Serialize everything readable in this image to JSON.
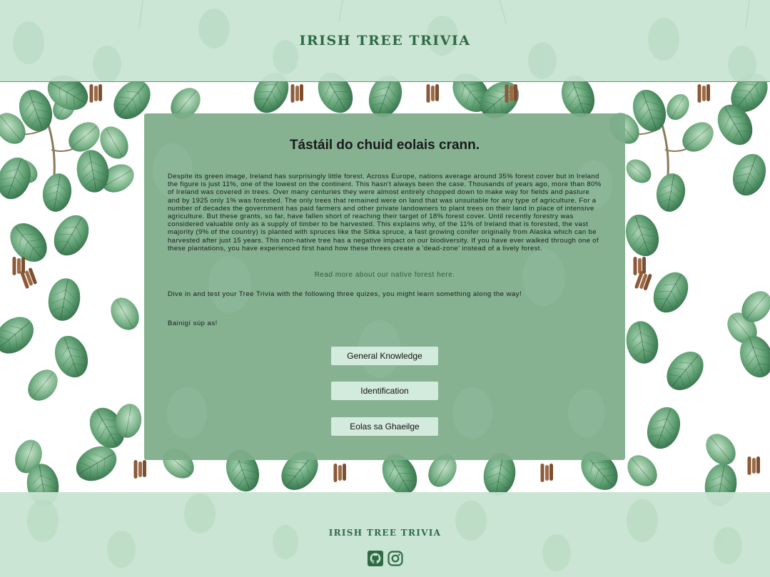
{
  "header": {
    "title": "IRISH TREE TRIVIA"
  },
  "main": {
    "heading": "Tástáil do chuid eolais crann.",
    "intro": "Despite its green image, Ireland has surprisingly little forest. Across Europe, nations average around 35% forest cover but in Ireland the figure is just 11%, one of the lowest on the continent. This hasn't always been the case. Thousands of years ago, more than 80% of Ireland was covered in trees. Over many centuries they were almost entirely chopped down to make way for fields and pasture and by 1925 only 1% was forested. The only trees that remained were on land that was unsuitable for any type of agriculture. For a number of decades the government has paid farmers and other private landowners to plant trees on their land in place of intensive agriculture. But these grants, so far, have fallen short of reaching their target of 18% forest cover. Until recently forestry was considered valuable only as a supply of timber to be harvested. This explains why, of the 11% of Ireland that is forested, the vast majority (9% of the country) is planted with spruces like the Sitka spruce, a fast growing conifer originally from Alaska which can be harvested after just 15 years. This non-native tree has a negative impact on our biodiversity. If you have ever walked through one of these plantations, you have experienced first hand how these threes create a 'dead-zone' instead of a lively forest.",
    "read_more": "Read more about our native forest here.",
    "dive_in": "Dive in and test your Tree Trivia with the following three quizes, you might learn something along the way!",
    "farewell": "Bainigí súp as!",
    "buttons": {
      "general_knowledge": "General Knowledge",
      "identification": "Identification",
      "eolas": "Eolas sa Ghaeilge"
    }
  },
  "footer": {
    "title": "IRISH TREE TRIVIA",
    "icons": [
      "github-icon",
      "instagram-icon"
    ]
  },
  "colors": {
    "header_bg": "#c8e4d2",
    "title_green": "#2f6a45",
    "card_bg": "#7dac8a",
    "button_bg": "#d3ebdc",
    "leaf_green": "#4f8f64"
  }
}
